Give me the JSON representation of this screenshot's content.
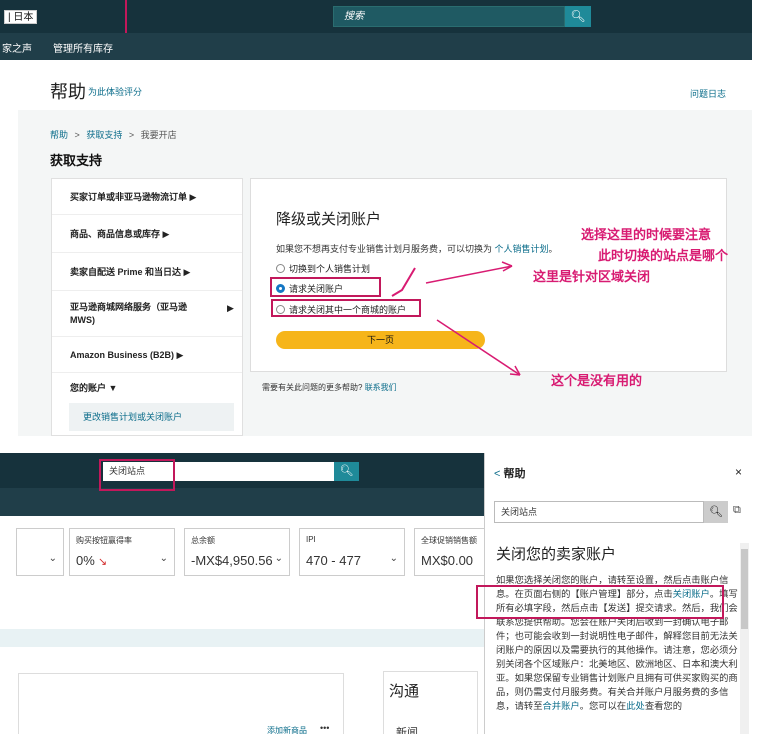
{
  "top": {
    "lang": "| 日本",
    "search_placeholder": "搜索",
    "nav2": [
      "家之声",
      "管理所有库存"
    ],
    "help_title": "帮助",
    "rate_link": "为此体验评分",
    "issue_log": "问题日志",
    "breadcrumb": [
      "帮助",
      ">",
      "获取支持",
      ">",
      "我要开店"
    ],
    "get_support": "获取支持",
    "left_nav": [
      "买家订单或非亚马逊物流订单  ▶",
      "商品、商品信息或库存  ▶",
      "卖家自配送 Prime 和当日达  ▶",
      "亚马逊商城网络服务（亚马逊",
      "MWS)",
      "Amazon Business (B2B)  ▶",
      "您的账户  ▼"
    ],
    "left_nav_arrow": "▶",
    "left_nav_sub": "更改销售计划或关闭账户",
    "card": {
      "title": "降级或关闭账户",
      "desc": "如果您不想再支付专业销售计划月服务费，可以切换为",
      "desc_link": "个人销售计划",
      "desc_end": "。",
      "options": [
        "切换到个人销售计划",
        "请求关闭账户",
        "请求关闭其中一个商城的账户"
      ],
      "next_button": "下一页"
    },
    "more_help": "需要有关此问题的更多帮助?",
    "contact": "联系我们",
    "annotations": {
      "note1_line1": "选择这里的时候要注意",
      "note1_line2": "此时切换的站点是哪个",
      "note2": "这里是针对区域关闭",
      "note3": "这个是没有用的"
    }
  },
  "bottom": {
    "search_value": "关闭站点",
    "metrics": [
      {
        "label": "",
        "value": ""
      },
      {
        "label": "购买按钮赢得率",
        "value": "0%"
      },
      {
        "label": "总余额",
        "value": "-MX$4,950.56"
      },
      {
        "label": "IPI",
        "value": "470 - 477"
      },
      {
        "label": "全球促销销售额",
        "value": "MX$0.00"
      }
    ],
    "add_product": "添加新商品",
    "more_dots": "•••",
    "comm_title": "沟通",
    "comm_news": "新闻",
    "help_panel": {
      "back": "<",
      "title": "帮助",
      "close": "×",
      "search_value": "关闭站点",
      "article_title": "关闭您的卖家账户",
      "body_1": "如果您选择关闭您的账户，请转至设置，然后点击账户信息。在页面右侧的【账户管理】部分，点击",
      "body_link1": "关闭账户",
      "body_2": "。填写所有必填字段，然后点击【发送】提交请求。然后，我们会联系您提供帮助。您会在账户关闭后收到一封确认电子邮件；也可能会收到一封说明性电子邮件，解释您目前无法关闭账户的原因以及需要执行的其他操作。请注意，您必须分别关闭各个区域账户：北美地区、欧洲地区、日本和澳大利亚。如果您保留专业销售计划账户且拥有可供买家购买的商品，则仍需支付月服务费。有关合并账户月服务费的多信息，请转至",
      "body_link2": "合并账户",
      "body_3": "。您可以在",
      "body_link3": "此处",
      "body_4": "查看您的"
    }
  },
  "colors": {
    "accent": "#d81b72",
    "dark_header": "#16323c",
    "button": "#f6b51a",
    "link": "#0a6c8a"
  }
}
